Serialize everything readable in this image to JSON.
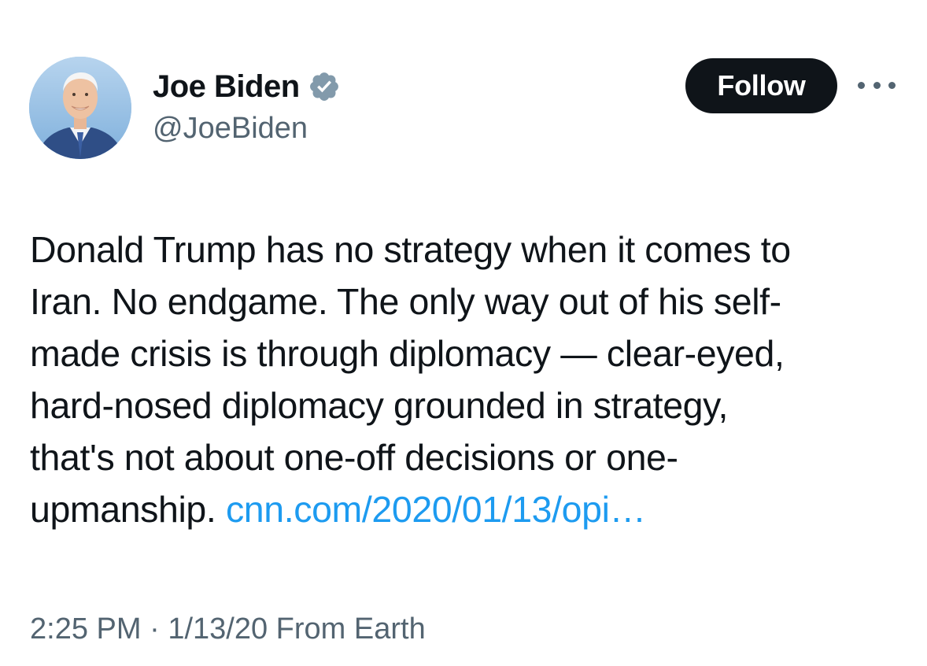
{
  "author": {
    "display_name": "Joe Biden",
    "handle": "@JoeBiden",
    "verified": true,
    "verified_icon": "verified-badge-icon",
    "verified_color": "#829aab"
  },
  "actions": {
    "follow_label": "Follow",
    "more_icon": "more-horizontal-icon"
  },
  "tweet": {
    "lines": [
      "Donald Trump has no strategy when it comes to",
      "Iran. No endgame. The only way out of his self-",
      "made crisis is through diplomacy — clear-eyed,",
      "hard-nosed diplomacy grounded in strategy,",
      "that's not about one-off decisions or one-",
      "upmanship."
    ],
    "link_text": "cnn.com/2020/01/13/opi…",
    "link_color": "#1d9bf0"
  },
  "meta": {
    "time": "2:25 PM",
    "separator": "·",
    "date": "1/13/20",
    "source": "From Earth"
  }
}
